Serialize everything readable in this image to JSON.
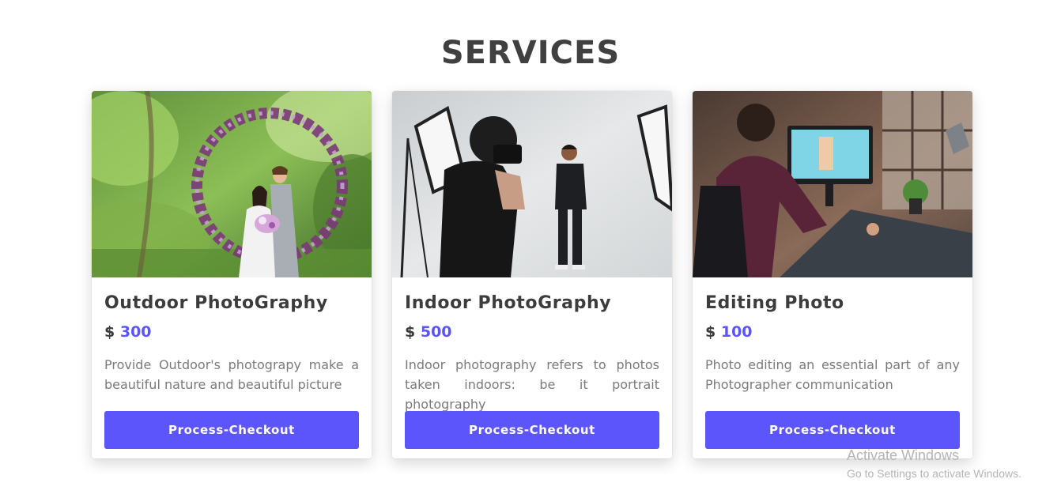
{
  "section": {
    "title": "SERVICES"
  },
  "cards": [
    {
      "title": "Outdoor PhotoGraphy",
      "currency": "$",
      "price": "300",
      "description": "Provide Outdoor's photograpy make a beautiful nature and beautiful picture",
      "button_label": "Process-Checkout"
    },
    {
      "title": "Indoor PhotoGraphy",
      "currency": "$",
      "price": "500",
      "description": "Indoor photography refers to photos taken indoors: be it portrait photography",
      "button_label": "Process-Checkout"
    },
    {
      "title": "Editing Photo",
      "currency": "$",
      "price": "100",
      "description": "Photo editing an essential part of any Photographer communication",
      "button_label": "Process-Checkout"
    }
  ],
  "watermark": {
    "title": "Activate Windows",
    "subtitle": "Go to Settings to activate Windows."
  },
  "colors": {
    "accent": "#5b55fb",
    "price": "#5b55f5",
    "heading": "#404040",
    "text_muted": "#7a7a7a"
  }
}
